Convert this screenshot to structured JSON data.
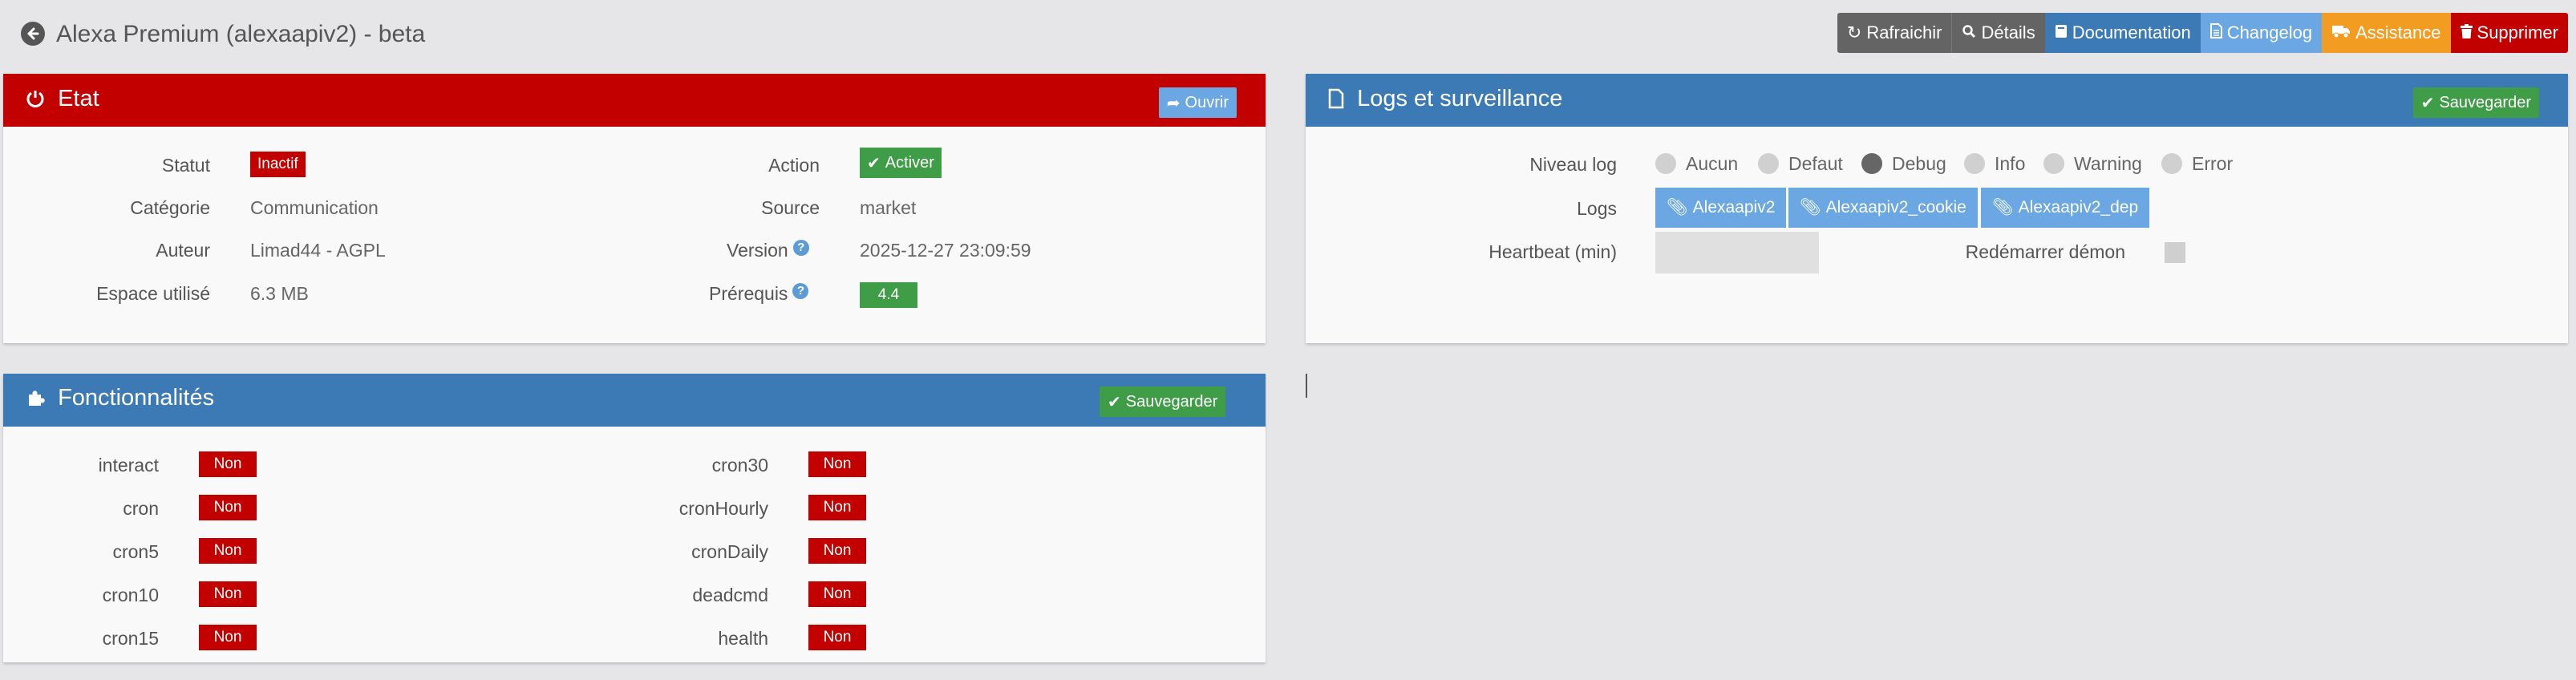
{
  "header": {
    "back_icon": "arrow-circle-left-icon",
    "title": "Alexa Premium (alexaapiv2) - beta"
  },
  "toolbar": {
    "refresh": "Rafraichir",
    "details": "Détails",
    "documentation": "Documentation",
    "changelog": "Changelog",
    "assistance": "Assistance",
    "delete": "Supprimer"
  },
  "etat": {
    "title": "Etat",
    "open_button": "Ouvrir",
    "statut_label": "Statut",
    "statut_value": "Inactif",
    "categorie_label": "Catégorie",
    "categorie_value": "Communication",
    "auteur_label": "Auteur",
    "auteur_value": "Limad44 - AGPL",
    "espace_label": "Espace utilisé",
    "espace_value": "6.3 MB",
    "action_label": "Action",
    "action_value": "Activer",
    "source_label": "Source",
    "source_value": "market",
    "version_label": "Version",
    "version_value": "2025-12-27 23:09:59",
    "prerequis_label": "Prérequis",
    "prerequis_value": "4.4",
    "help_glyph": "?"
  },
  "logs": {
    "title": "Logs et surveillance",
    "save_button": "Sauvegarder",
    "niveau_label": "Niveau log",
    "levels": [
      "Aucun",
      "Defaut",
      "Debug",
      "Info",
      "Warning",
      "Error"
    ],
    "selected_level": "Debug",
    "logs_label": "Logs",
    "log_files": [
      "Alexaapiv2",
      "Alexaapiv2_cookie",
      "Alexaapiv2_dep"
    ],
    "heartbeat_label": "Heartbeat (min)",
    "heartbeat_value": "",
    "restart_label": "Redémarrer démon"
  },
  "fonctions": {
    "title": "Fonctionnalités",
    "save_button": "Sauvegarder",
    "left": [
      {
        "name": "interact",
        "value": "Non"
      },
      {
        "name": "cron",
        "value": "Non"
      },
      {
        "name": "cron5",
        "value": "Non"
      },
      {
        "name": "cron10",
        "value": "Non"
      },
      {
        "name": "cron15",
        "value": "Non"
      }
    ],
    "right": [
      {
        "name": "cron30",
        "value": "Non"
      },
      {
        "name": "cronHourly",
        "value": "Non"
      },
      {
        "name": "cronDaily",
        "value": "Non"
      },
      {
        "name": "deadcmd",
        "value": "Non"
      },
      {
        "name": "health",
        "value": "Non"
      }
    ]
  },
  "colors": {
    "red": "#c20000",
    "blue": "#3c7ab5",
    "light_blue": "#6aa7e3",
    "green": "#3e9d46",
    "orange": "#f29c22",
    "grey": "#646464"
  }
}
